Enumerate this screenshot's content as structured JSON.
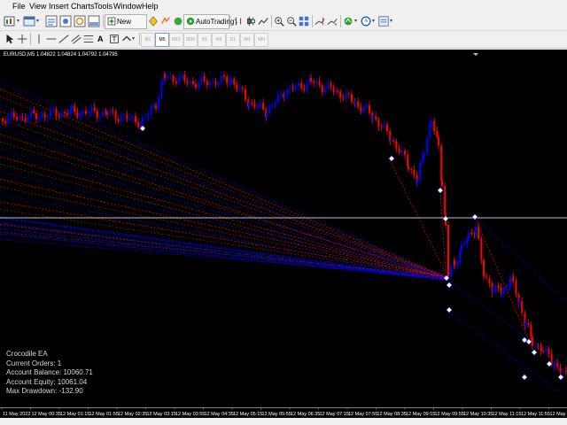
{
  "menu": [
    "File",
    "View",
    "Insert",
    "Charts",
    "Tools",
    "Window",
    "Help"
  ],
  "toolbar": {
    "new_order_label": "New Order",
    "autotrading_label": "AutoTrading",
    "timeframes": [
      "M1",
      "M5",
      "M15",
      "M30",
      "H1",
      "H4",
      "D1",
      "W1",
      "MN"
    ],
    "active_timeframe": "M5"
  },
  "chart": {
    "title": "EURUSD,M5  1.04822 1.04824 1.04792 1.04795",
    "background_color": "#000000",
    "bull_color": "#0000ff",
    "bear_color": "#ff0000",
    "line_color": "#ffffff"
  },
  "ea_panel": {
    "name": "Crocodile EA",
    "current_orders": "Current Orders:  1",
    "account_balance": "Account Balance:  10060.71",
    "account_equity": "Account Equity:  10061.04",
    "max_drawdown": "Max Drawdown:  -132.90"
  },
  "time_axis": [
    "11 May 2022",
    "12 May 00:35",
    "12 May 01:15",
    "12 May 01:55",
    "12 May 02:35",
    "12 May 03:15",
    "12 May 03:55",
    "12 May 04:35",
    "12 May 05:15",
    "12 May 05:55",
    "12 May 06:35",
    "12 May 07:15",
    "12 May 07:55",
    "12 May 08:35",
    "12 May 09:15",
    "12 May 09:55",
    "12 May 10:35",
    "12 May 11:15",
    "12 May 11:55",
    "12 May 12:35"
  ]
}
